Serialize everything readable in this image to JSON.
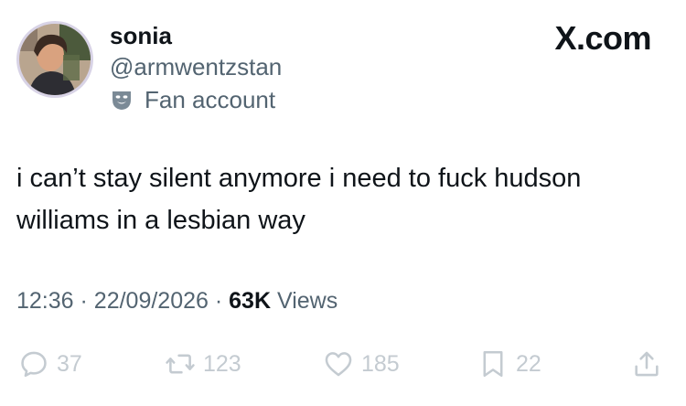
{
  "author": {
    "display_name": "sonia",
    "handle": "@armwentzstan",
    "affiliation": "Fan account",
    "affiliation_icon": "theater-masks-icon"
  },
  "brand": "X.com",
  "tweet": {
    "text": "i can’t stay silent anymore i need to fuck hudson williams in a lesbian way",
    "time": "12:36",
    "date": "22/09/2026",
    "views_count": "63K",
    "views_label": "Views"
  },
  "actions": {
    "replies": "37",
    "reposts": "123",
    "likes": "185",
    "bookmarks": "22"
  },
  "colors": {
    "text": "#0f1419",
    "secondary": "#536471",
    "action_icon": "#c4cbd1"
  }
}
